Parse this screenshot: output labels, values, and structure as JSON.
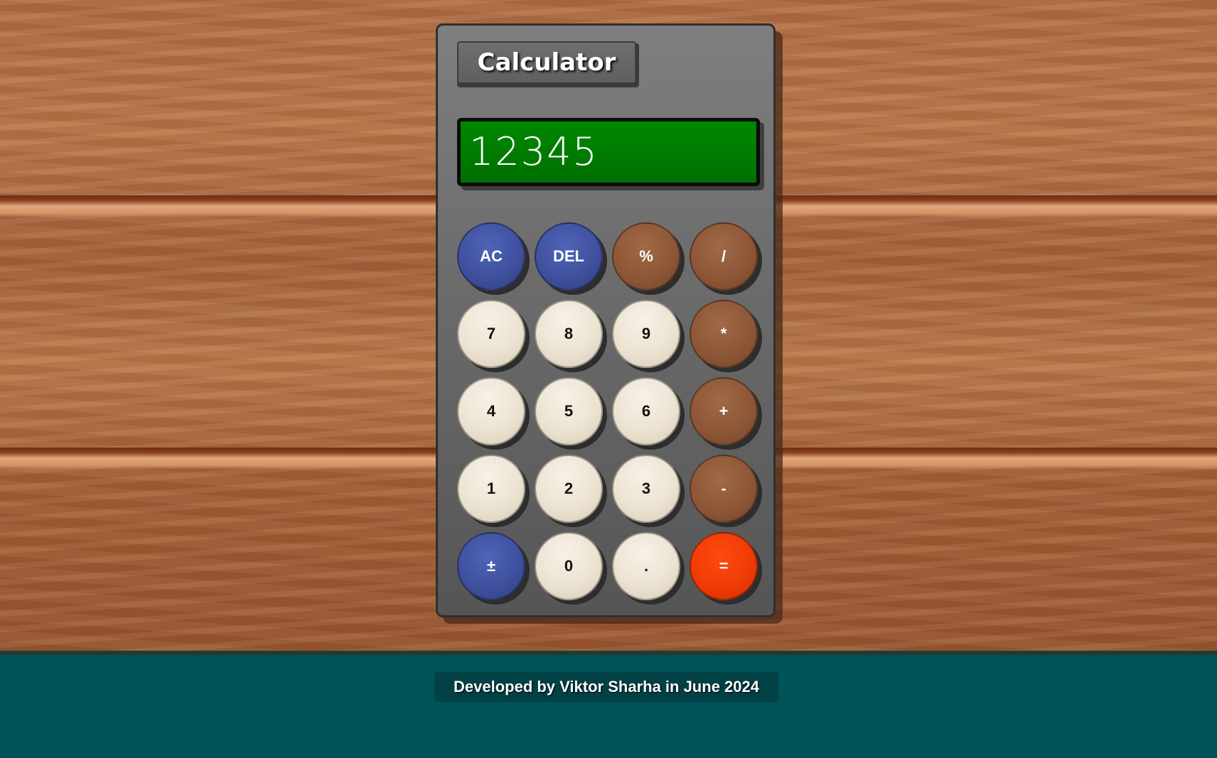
{
  "app": {
    "title": "Calculator"
  },
  "display": {
    "value": "12345"
  },
  "keys": {
    "ac": "AC",
    "del": "DEL",
    "percent": "%",
    "divide": "/",
    "seven": "7",
    "eight": "8",
    "nine": "9",
    "multiply": "*",
    "four": "4",
    "five": "5",
    "six": "6",
    "plus": "+",
    "one": "1",
    "two": "2",
    "three": "3",
    "minus": "-",
    "plus_minus": "±",
    "zero": "0",
    "decimal": ".",
    "equals": "="
  },
  "colors": {
    "display_bg": "#007a00",
    "function_key": "#3e4f9c",
    "operator_key": "#8c5636",
    "digit_key": "#ece3d2",
    "equals_key": "#ee3a05",
    "footer_bg": "#005357"
  },
  "footer": {
    "credit": "Developed by Viktor Sharha in June 2024"
  }
}
